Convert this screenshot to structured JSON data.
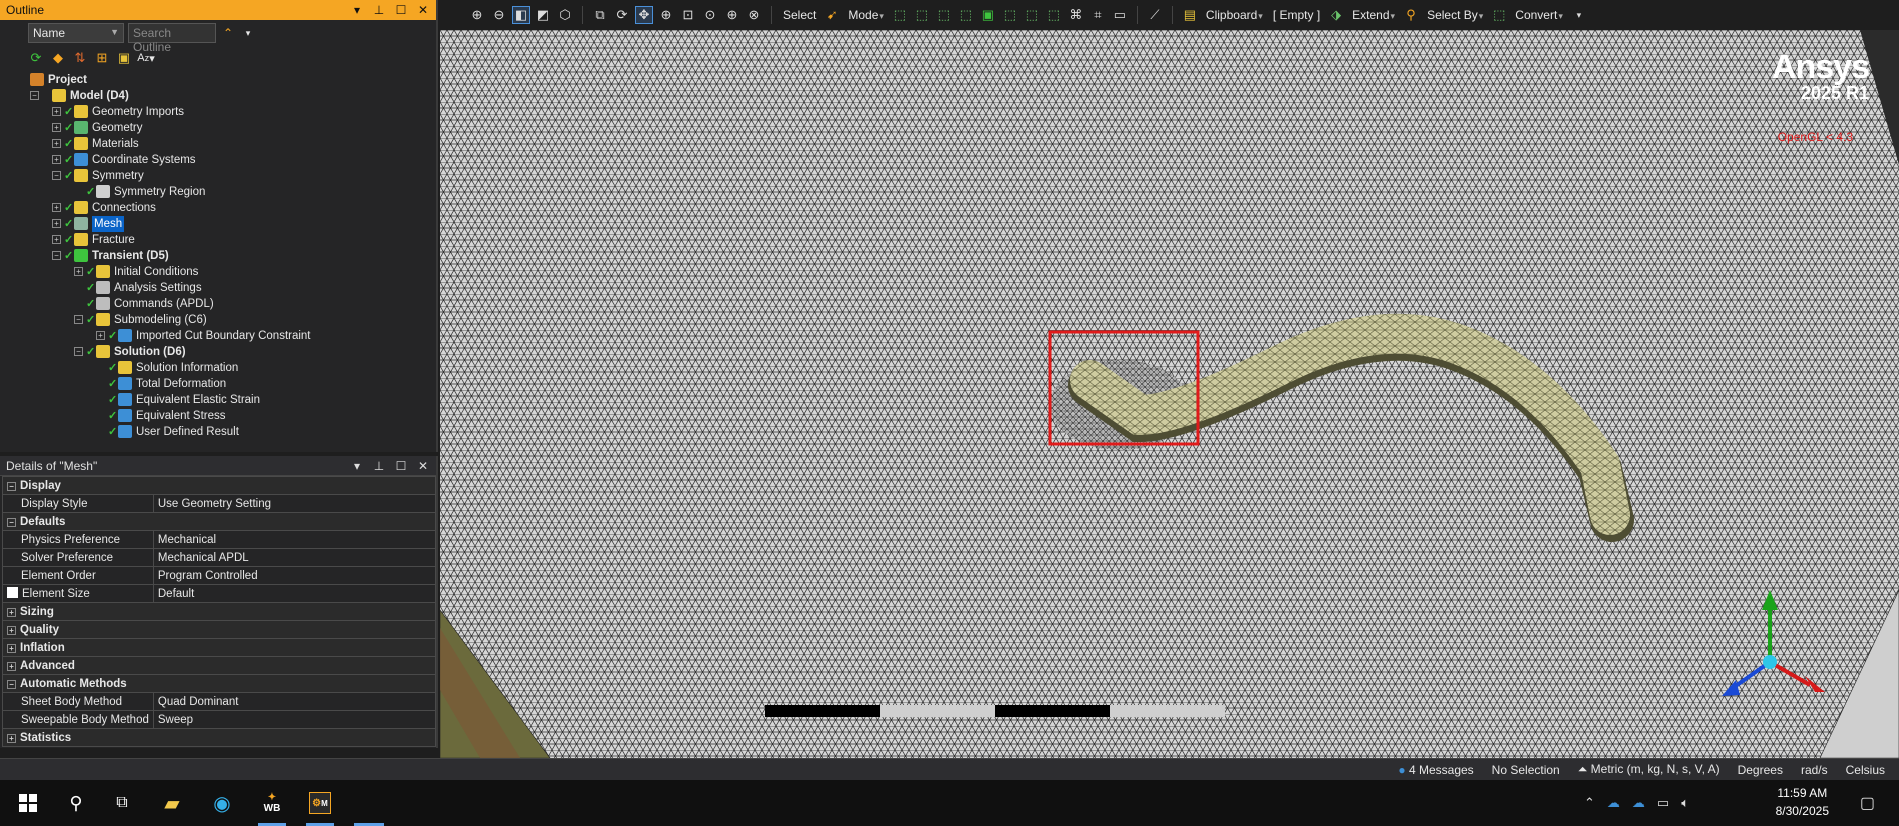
{
  "outline": {
    "title": "Outline",
    "filter_select": "Name",
    "search_placeholder": "Search Outline",
    "tree": [
      {
        "label": "Project",
        "bold": true,
        "level": 0,
        "icon_color": "#d4822a",
        "expander": "",
        "check": false
      },
      {
        "label": "Model (D4)",
        "bold": true,
        "level": 1,
        "icon_color": "#e8c43a",
        "expander": "−",
        "check": false
      },
      {
        "label": "Geometry Imports",
        "level": 2,
        "icon_color": "#e8c43a",
        "expander": "+",
        "check": true
      },
      {
        "label": "Geometry",
        "level": 2,
        "icon_color": "#59b56f",
        "expander": "+",
        "check": true
      },
      {
        "label": "Materials",
        "level": 2,
        "icon_color": "#e8c43a",
        "expander": "+",
        "check": true
      },
      {
        "label": "Coordinate Systems",
        "level": 2,
        "icon_color": "#3d8fd6",
        "expander": "+",
        "check": true
      },
      {
        "label": "Symmetry",
        "level": 2,
        "icon_color": "#e8c43a",
        "expander": "−",
        "check": true
      },
      {
        "label": "Symmetry Region",
        "level": 3,
        "icon_color": "#cfcfcf",
        "expander": "",
        "check": true
      },
      {
        "label": "Connections",
        "level": 2,
        "icon_color": "#e8c43a",
        "expander": "+",
        "check": true
      },
      {
        "label": "Mesh",
        "level": 2,
        "icon_color": "#8fb4a0",
        "expander": "+",
        "check": true,
        "selected": true
      },
      {
        "label": "Fracture",
        "level": 2,
        "icon_color": "#e8c43a",
        "expander": "+",
        "check": true
      },
      {
        "label": "Transient (D5)",
        "bold": true,
        "level": 2,
        "icon_color": "#3ec43e",
        "expander": "−",
        "check": true
      },
      {
        "label": "Initial Conditions",
        "level": 3,
        "icon_color": "#e8c43a",
        "expander": "+",
        "check": true
      },
      {
        "label": "Analysis Settings",
        "level": 3,
        "icon_color": "#bdbdbd",
        "expander": "",
        "check": true
      },
      {
        "label": "Commands (APDL)",
        "level": 3,
        "icon_color": "#bdbdbd",
        "expander": "",
        "check": true
      },
      {
        "label": "Submodeling (C6)",
        "level": 3,
        "icon_color": "#e8c43a",
        "expander": "−",
        "check": true
      },
      {
        "label": "Imported Cut Boundary Constraint",
        "level": 4,
        "icon_color": "#3d8fd6",
        "expander": "+",
        "check": true
      },
      {
        "label": "Solution (D6)",
        "bold": true,
        "level": 3,
        "icon_color": "#e8c43a",
        "expander": "−",
        "check": true
      },
      {
        "label": "Solution Information",
        "level": 4,
        "icon_color": "#e8c43a",
        "expander": "",
        "check": true
      },
      {
        "label": "Total Deformation",
        "level": 4,
        "icon_color": "#3d8fd6",
        "expander": "",
        "check": true
      },
      {
        "label": "Equivalent Elastic Strain",
        "level": 4,
        "icon_color": "#3d8fd6",
        "expander": "",
        "check": true
      },
      {
        "label": "Equivalent Stress",
        "level": 4,
        "icon_color": "#3d8fd6",
        "expander": "",
        "check": true
      },
      {
        "label": "User Defined Result",
        "level": 4,
        "icon_color": "#3d8fd6",
        "expander": "",
        "check": true
      }
    ]
  },
  "details": {
    "title": "Details of \"Mesh\"",
    "rows": [
      {
        "type": "group",
        "label": "Display",
        "expander": "−"
      },
      {
        "type": "prop",
        "key": "Display Style",
        "value": "Use Geometry Setting"
      },
      {
        "type": "group",
        "label": "Defaults",
        "expander": "−"
      },
      {
        "type": "prop",
        "key": "Physics Preference",
        "value": "Mechanical"
      },
      {
        "type": "prop",
        "key": "Solver Preference",
        "value": "Mechanical APDL"
      },
      {
        "type": "prop",
        "key": "Element Order",
        "value": "Program Controlled"
      },
      {
        "type": "prop",
        "key": "Element Size",
        "value": "Default",
        "checkbox": true
      },
      {
        "type": "group",
        "label": "Sizing",
        "expander": "+"
      },
      {
        "type": "group",
        "label": "Quality",
        "expander": "+"
      },
      {
        "type": "group",
        "label": "Inflation",
        "expander": "+"
      },
      {
        "type": "group",
        "label": "Advanced",
        "expander": "+"
      },
      {
        "type": "group",
        "label": "Automatic Methods",
        "expander": "−"
      },
      {
        "type": "prop",
        "key": "Sheet Body Method",
        "value": "Quad Dominant"
      },
      {
        "type": "prop",
        "key": "Sweepable Body Method",
        "value": "Sweep"
      },
      {
        "type": "group",
        "label": "Statistics",
        "expander": "+"
      }
    ]
  },
  "toolbar": {
    "select": "Select",
    "mode": "Mode",
    "clipboard": "Clipboard",
    "empty": "[ Empty ]",
    "extend": "Extend",
    "select_by": "Select By",
    "convert": "Convert"
  },
  "viewport": {
    "brand": "Ansys",
    "version": "2025 R1",
    "opengl_warning": "OpenGL < 4.3"
  },
  "statusbar": {
    "messages": "4 Messages",
    "selection": "No Selection",
    "units": "Metric (m, kg, N, s, V, A)",
    "angle": "Degrees",
    "rate": "rad/s",
    "temp": "Celsius"
  },
  "taskbar": {
    "time": "11:59 AM",
    "date": "8/30/2025",
    "wb_label": "WB",
    "m_label": "M"
  },
  "colors": {
    "accent": "#f5a623",
    "selection": "#0a64c8",
    "check": "#3ec43e",
    "highlight_box": "#e01b1b"
  }
}
